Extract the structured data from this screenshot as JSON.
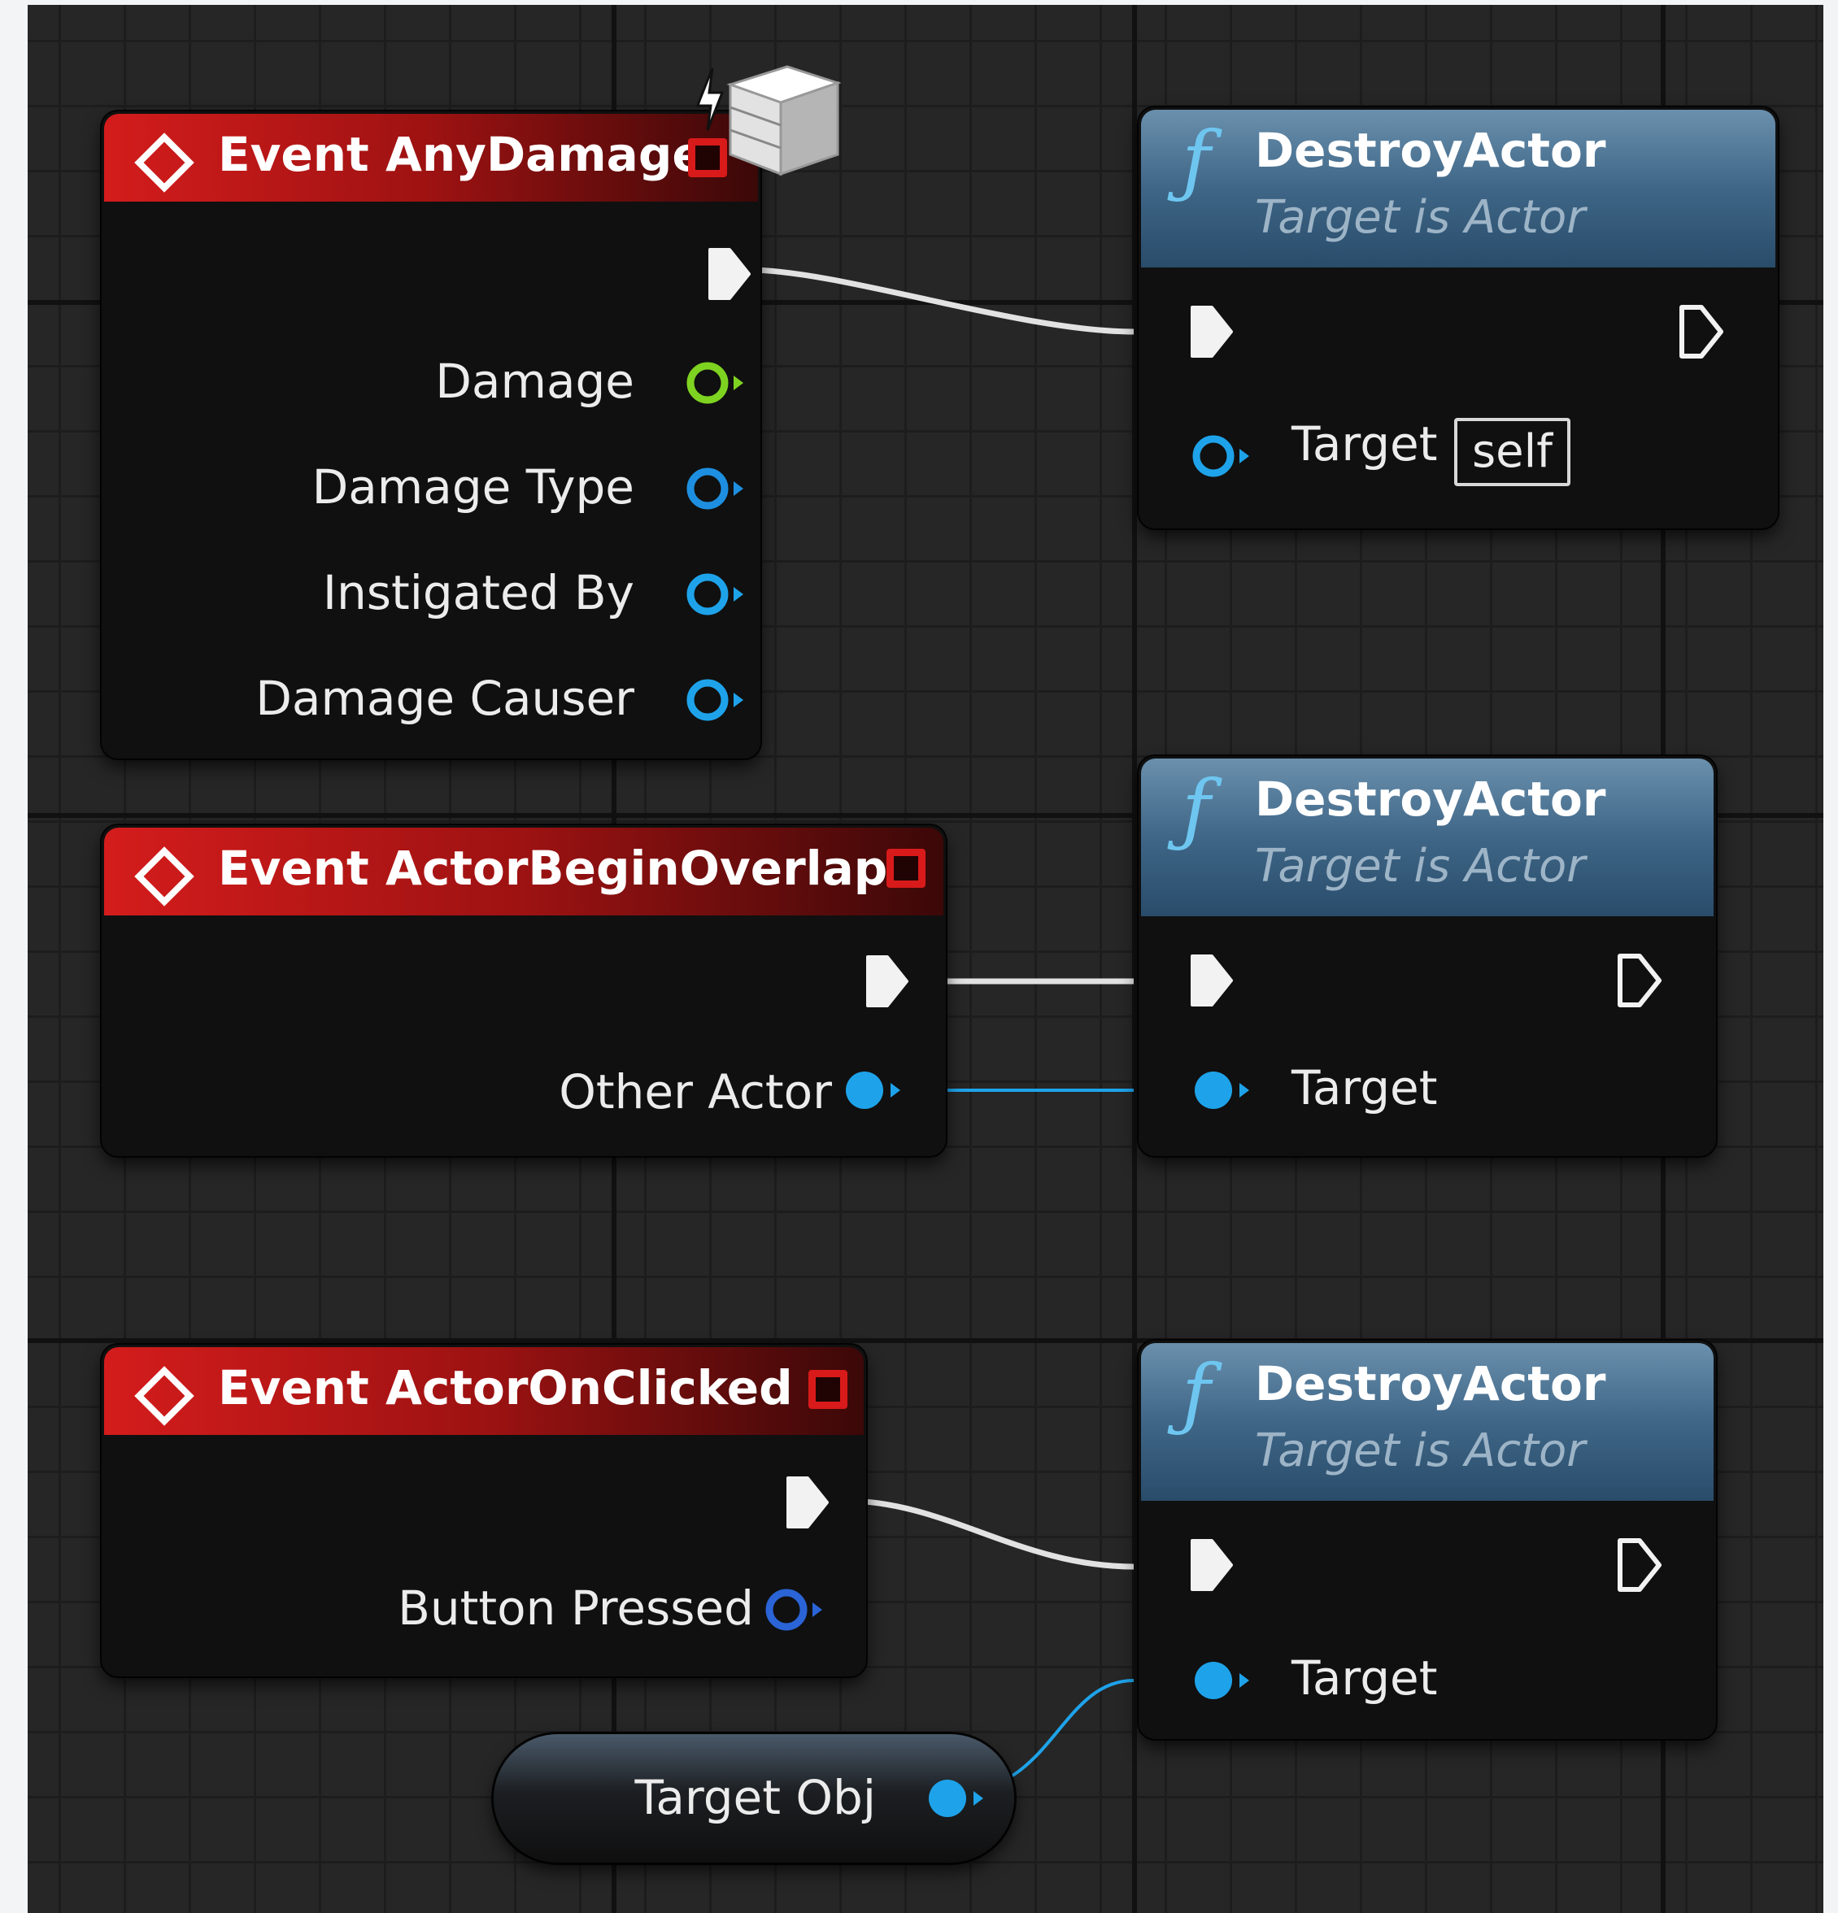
{
  "nodes": {
    "any_damage": {
      "title": "Event AnyDamage",
      "pins": {
        "damage": "Damage",
        "damage_type": "Damage Type",
        "instigated_by": "Instigated By",
        "damage_causer": "Damage Causer"
      }
    },
    "begin_overlap": {
      "title": "Event ActorBeginOverlap",
      "pins": {
        "other_actor": "Other Actor"
      }
    },
    "on_clicked": {
      "title": "Event ActorOnClicked",
      "pins": {
        "button_pressed": "Button Pressed"
      }
    },
    "destroy_1": {
      "title": "DestroyActor",
      "subtitle": "Target is Actor",
      "target_label": "Target",
      "target_default": "self"
    },
    "destroy_2": {
      "title": "DestroyActor",
      "subtitle": "Target is Actor",
      "target_label": "Target"
    },
    "destroy_3": {
      "title": "DestroyActor",
      "subtitle": "Target is Actor",
      "target_label": "Target"
    },
    "target_obj": {
      "label": "Target Obj"
    }
  },
  "icons": {
    "function": "ƒ",
    "event": "diamond-icon",
    "exec": "exec-pin-icon",
    "object_pin": "object-pin-icon",
    "float_pin": "float-pin-icon",
    "class_pin": "class-pin-icon"
  },
  "colors": {
    "event_header": "#d41c1c",
    "function_header": "#3f6687",
    "float_pin": "#7ed321",
    "object_pin": "#1ea3ea",
    "class_pin": "#2a64d6",
    "exec_wire": "#e8e8e8",
    "graph_bg": "#262626"
  }
}
